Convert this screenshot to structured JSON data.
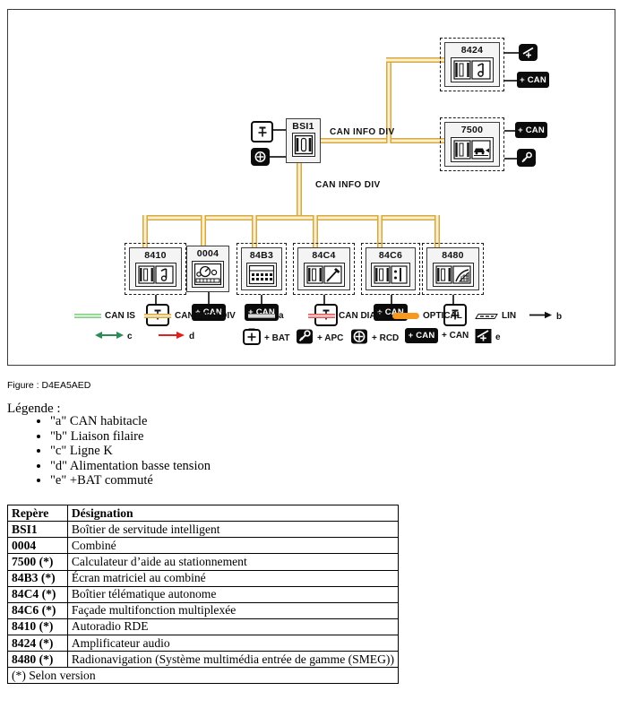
{
  "figure": {
    "caption": "Figure : D4EA5AED",
    "bus_labels": {
      "top": "CAN INFO DIV",
      "bottom": "CAN INFO DIV"
    },
    "colors": {
      "can_is": "#7fcf7f",
      "can_info_div": "#d8a93f",
      "can_info_div_light": "#fbf0cf",
      "a_grey": "#9a9a9a",
      "can_diag": "#e35b5b",
      "optical": "#f59a1e",
      "badge_black": "#0b0b0b",
      "frame": "#3a3a3a"
    },
    "bsi": {
      "code": "BSI1",
      "icon": "bsi-connector-icon",
      "inputs": [
        {
          "name": "bat-icon",
          "label": "+ BAT"
        },
        {
          "name": "rcd-icon",
          "label": "+ RCD"
        }
      ]
    },
    "top_nodes": [
      {
        "code": "8424",
        "icon": "connector-speaker-icon",
        "dashed": true,
        "outputs": [
          {
            "type": "icon",
            "name": "switched-bat-icon",
            "label": ""
          },
          {
            "type": "badge",
            "name": "plus-can-badge",
            "label": "+ CAN"
          }
        ]
      },
      {
        "code": "7500",
        "icon": "connector-parking-car-icon",
        "dashed": true,
        "outputs": [
          {
            "type": "badge",
            "name": "plus-can-badge",
            "label": "+ CAN"
          },
          {
            "type": "icon",
            "name": "key-apc-icon",
            "label": ""
          }
        ]
      }
    ],
    "bottom_nodes": [
      {
        "code": "8410",
        "icon": "connector-speaker-icon",
        "dashed": true,
        "supply": {
          "type": "icon",
          "name": "bat-icon",
          "label": ""
        }
      },
      {
        "code": "0004",
        "icon": "instrument-cluster-icon",
        "dashed": false,
        "supply": {
          "type": "badge",
          "name": "plus-can-badge",
          "label": "+ CAN"
        }
      },
      {
        "code": "84B3",
        "icon": "matrix-screen-icon",
        "dashed": true,
        "supply": {
          "type": "badge",
          "name": "plus-can-badge",
          "label": "+ CAN"
        }
      },
      {
        "code": "84C4",
        "icon": "connector-mic-icon",
        "dashed": true,
        "supply": {
          "type": "icon",
          "name": "bat-icon",
          "label": ""
        }
      },
      {
        "code": "84C6",
        "icon": "connector-keypad-icon",
        "dashed": true,
        "supply": {
          "type": "badge",
          "name": "plus-can-badge",
          "label": "+ CAN"
        }
      },
      {
        "code": "8480",
        "icon": "connector-navmap-icon",
        "dashed": true,
        "supply": {
          "type": "icon",
          "name": "bat-icon",
          "label": ""
        }
      }
    ],
    "legend_row1": [
      {
        "swatch": "can-is-line",
        "label": "CAN IS"
      },
      {
        "swatch": "can-info-div-line",
        "label": "CAN INFO DIV"
      },
      {
        "swatch": "grey-line",
        "label": "a"
      },
      {
        "swatch": "can-diag-line",
        "label": "CAN DIAG"
      },
      {
        "swatch": "optical-bar",
        "label": "OPTICAL"
      },
      {
        "swatch": "lin-hatched",
        "label": "LIN"
      },
      {
        "swatch": "black-arrow",
        "label": "b"
      }
    ],
    "legend_row2": [
      {
        "swatch": "green-double-arrow",
        "label": "c"
      },
      {
        "swatch": "red-arrow",
        "label": "d"
      },
      {
        "swatch": "bat-icon",
        "label": "+ BAT"
      },
      {
        "swatch": "key-apc-icon",
        "label": "+ APC"
      },
      {
        "swatch": "rcd-icon",
        "label": "+ RCD"
      },
      {
        "swatch": "plus-can-badge",
        "label": "+ CAN"
      },
      {
        "swatch": "switched-bat-icon",
        "label": "e"
      }
    ]
  },
  "legende": {
    "title": "Légende :",
    "items": [
      "\"a\" CAN habitacle",
      "\"b\" Liaison filaire",
      "\"c\" Ligne K",
      "\"d\" Alimentation basse tension",
      "\"e\" +BAT commuté"
    ]
  },
  "table": {
    "headers": [
      "Repère",
      "Désignation"
    ],
    "rows": [
      [
        "BSI1",
        "Boîtier de servitude intelligent"
      ],
      [
        "0004",
        "Combiné"
      ],
      [
        "7500 (*)",
        "Calculateur d’aide au stationnement"
      ],
      [
        "84B3 (*)",
        "Écran matriciel au combiné"
      ],
      [
        "84C4 (*)",
        "Boîtier télématique autonome"
      ],
      [
        "84C6 (*)",
        "Façade multifonction multiplexée"
      ],
      [
        "8410 (*)",
        "Autoradio RDE"
      ],
      [
        "8424 (*)",
        "Amplificateur audio"
      ],
      [
        "8480 (*)",
        "Radionavigation (Système multimédia entrée de gamme (SMEG))"
      ]
    ],
    "footer": "(*) Selon version"
  }
}
